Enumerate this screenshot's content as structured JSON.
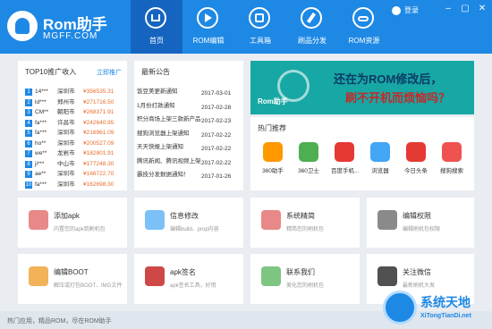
{
  "app": {
    "brand": "Rom助手",
    "site": "MGFF.COM"
  },
  "nav": [
    {
      "label": "首页",
      "active": true
    },
    {
      "label": "ROM编辑"
    },
    {
      "label": "工具箱"
    },
    {
      "label": "刷品分发"
    },
    {
      "label": "ROM资源"
    }
  ],
  "user": {
    "login": "登录"
  },
  "top10": {
    "title": "TOP10推广收入",
    "more": "立即推广",
    "rows": [
      [
        "1",
        "14***",
        "深圳市",
        "¥356535.31"
      ],
      [
        "2",
        "ld***",
        "郑州市",
        "¥271716.50"
      ],
      [
        "3",
        "CM**",
        "朝阳市",
        "¥268371.91"
      ],
      [
        "4",
        "fa***",
        "许昌市",
        "¥242640.95"
      ],
      [
        "5",
        "fa***",
        "深圳市",
        "¥216961.09"
      ],
      [
        "6",
        "ho**",
        "深圳市",
        "¥200527.09"
      ],
      [
        "7",
        "we**",
        "龙岩市",
        "¥182801.91"
      ],
      [
        "8",
        "ji***",
        "中山市",
        "¥177248.30"
      ],
      [
        "9",
        "ae**",
        "深圳市",
        "¥166722.70"
      ],
      [
        "10",
        "fa***",
        "深圳市",
        "¥162698.30"
      ]
    ]
  },
  "news": {
    "title": "最新公告",
    "rows": [
      [
        "饭豆美更新通知",
        "2017-03-01"
      ],
      [
        "1月份打款通知",
        "2017-02-28"
      ],
      [
        "积分商场上架三款新产品",
        "2017-02-23"
      ],
      [
        "搜狗浏览器上架通知",
        "2017-02-22"
      ],
      [
        "天天快报上架通知",
        "2017-02-22"
      ],
      [
        "腾讯新闻、腾讯视频上架通知",
        "2017-02-22"
      ],
      [
        "霸技分发数据通知！",
        "2017-01-26"
      ]
    ]
  },
  "banner": {
    "brand": "Rom助手",
    "l1": "还在为ROM修改后，",
    "l2": "刷不开机而烦恼吗？"
  },
  "recommend": {
    "title": "热门推荐",
    "apps": [
      {
        "label": "360助手",
        "color": "#ff9800"
      },
      {
        "label": "360卫士",
        "color": "#4caf50"
      },
      {
        "label": "百度手机...",
        "color": "#e53935"
      },
      {
        "label": "浏览器",
        "color": "#42a5f5"
      },
      {
        "label": "今日头条",
        "color": "#e53935"
      },
      {
        "label": "搜狗搜索",
        "color": "#ef5350"
      }
    ]
  },
  "cards": [
    {
      "name": "添加apk",
      "desc": "内置您的apk到刷机包",
      "color": "#e57373"
    },
    {
      "name": "信息修改",
      "desc": "编辑build、prop内容",
      "color": "#64b5f6"
    },
    {
      "name": "系统精简",
      "desc": "精简您的刷机包",
      "color": "#e57373"
    },
    {
      "name": "编辑权限",
      "desc": "编辑刷机包权限",
      "color": "#757575"
    },
    {
      "name": "编辑BOOT",
      "desc": "解压或打包BOOT、IMG文件",
      "color": "#f0a43a"
    },
    {
      "name": "apk签名",
      "desc": "apk签名工具，好用",
      "color": "#c62828"
    },
    {
      "name": "联系我们",
      "desc": "美化您的刷机包",
      "color": "#66bb6a"
    },
    {
      "name": "关注微信",
      "desc": "最新刷机大发",
      "color": "#333333"
    }
  ],
  "status": {
    "text": "热门应用，精品ROM，尽在ROM助手"
  },
  "watermark": {
    "a": "系统天地",
    "b": "XiTongTianDi.net"
  }
}
